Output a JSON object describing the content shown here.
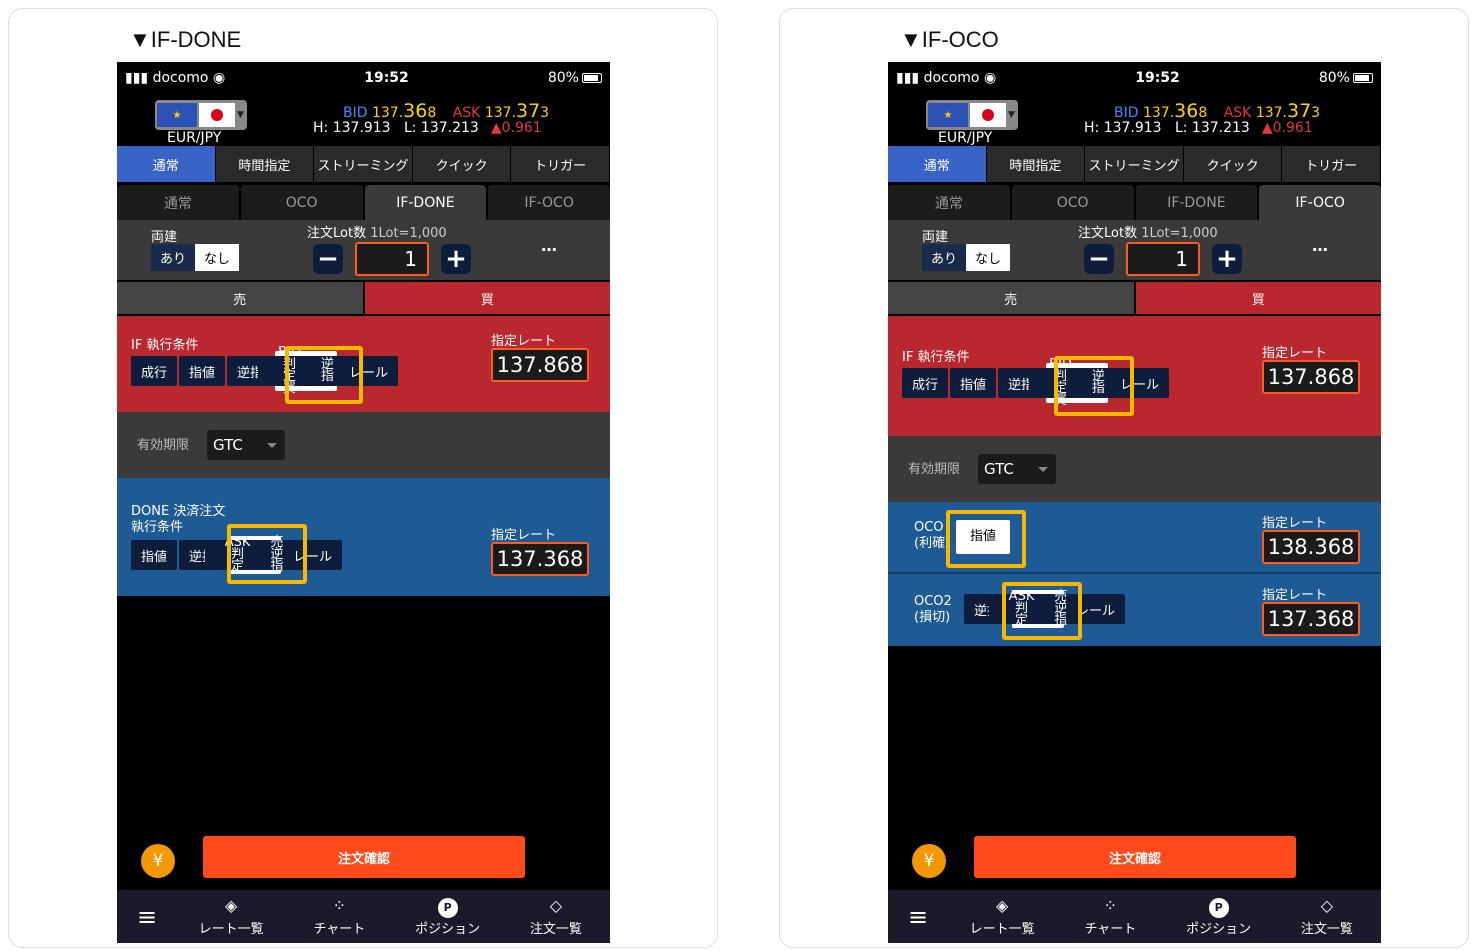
{
  "phones": [
    {
      "title": "▼IF-DONE",
      "status": {
        "carrier": "docomo",
        "time": "19:52",
        "battery": "80%"
      },
      "quote": {
        "pair": "EUR/JPY",
        "bid_label": "BID",
        "bid_prefix": "137.",
        "bid_big": "36",
        "bid_suffix": "8",
        "ask_label": "ASK",
        "ask_prefix": "137.",
        "ask_big": "37",
        "ask_suffix": "3",
        "high": "H: 137.913",
        "low": "L: 137.213",
        "change": "▲0.961"
      },
      "tabs1": [
        "通常",
        "時間指定",
        "ストリーミング",
        "クイック",
        "トリガー"
      ],
      "tabs1_active": 0,
      "tabs2": [
        "通常",
        "OCO",
        "IF-DONE",
        "IF-OCO"
      ],
      "tabs2_active": 2,
      "lot": {
        "ryodate_label": "両建",
        "ari": "あり",
        "nashi": "なし",
        "label": "注文Lot数",
        "unit": "1Lot=1,000",
        "value": "1",
        "more": "…"
      },
      "side": {
        "sell": "売",
        "buy": "買"
      },
      "if_section": {
        "label": "IF 執行条件",
        "buttons": [
          "成行",
          "指値",
          "逆指"
        ],
        "selected_line1": "BID判定買",
        "selected_line2": "逆指",
        "after": "レール",
        "rate_label": "指定レート",
        "rate": "137.868"
      },
      "expiry": {
        "label": "有効期限",
        "value": "GTC"
      },
      "done_section": {
        "label_line1": "DONE 決済注文",
        "label_line2": "執行条件",
        "buttons": [
          "指値",
          "逆指"
        ],
        "selected_line1": "ASK判定",
        "selected_line2": "売逆指",
        "after": "レール",
        "rate_label": "指定レート",
        "rate": "137.368"
      },
      "confirm": "注文確認",
      "yen": "¥",
      "nav": [
        "レート一覧",
        "チャート",
        "ポジション",
        "注文一覧"
      ]
    },
    {
      "title": "▼IF-OCO",
      "status": {
        "carrier": "docomo",
        "time": "19:52",
        "battery": "80%"
      },
      "quote": {
        "pair": "EUR/JPY",
        "bid_label": "BID",
        "bid_prefix": "137.",
        "bid_big": "36",
        "bid_suffix": "8",
        "ask_label": "ASK",
        "ask_prefix": "137.",
        "ask_big": "37",
        "ask_suffix": "3",
        "high": "H: 137.913",
        "low": "L: 137.213",
        "change": "▲0.961"
      },
      "tabs1": [
        "通常",
        "時間指定",
        "ストリーミング",
        "クイック",
        "トリガー"
      ],
      "tabs1_active": 0,
      "tabs2": [
        "通常",
        "OCO",
        "IF-DONE",
        "IF-OCO"
      ],
      "tabs2_active": 3,
      "lot": {
        "ryodate_label": "両建",
        "ari": "あり",
        "nashi": "なし",
        "label": "注文Lot数",
        "unit": "1Lot=1,000",
        "value": "1",
        "more": "…"
      },
      "side": {
        "sell": "売",
        "buy": "買"
      },
      "if_section": {
        "label": "IF 執行条件",
        "buttons": [
          "成行",
          "指値",
          "逆指"
        ],
        "selected_line1": "BID判定買",
        "selected_line2": "逆指",
        "after": "レール",
        "rate_label": "指定レート",
        "rate": "137.868"
      },
      "expiry": {
        "label": "有効期限",
        "value": "GTC"
      },
      "oco1": {
        "label_line1": "OCO",
        "label_line2": "(利確",
        "selected": "指値",
        "rate_label": "指定レート",
        "rate": "138.368"
      },
      "oco2": {
        "label_line1": "OCO2",
        "label_line2": "(損切)",
        "buttons": [
          "逆指"
        ],
        "selected_line1": "ASK判定",
        "selected_line2": "売逆指",
        "after": "レール",
        "rate_label": "指定レート",
        "rate": "137.368"
      },
      "confirm": "注文確認",
      "yen": "¥",
      "nav": [
        "レート一覧",
        "チャート",
        "ポジション",
        "注文一覧"
      ]
    }
  ],
  "colors": {
    "highlight": "#f6b800",
    "accent_blue": "#3a63c8",
    "sell_red": "#b8282e",
    "done_blue": "#1e5a93",
    "confirm_orange": "#ff4a1c"
  }
}
